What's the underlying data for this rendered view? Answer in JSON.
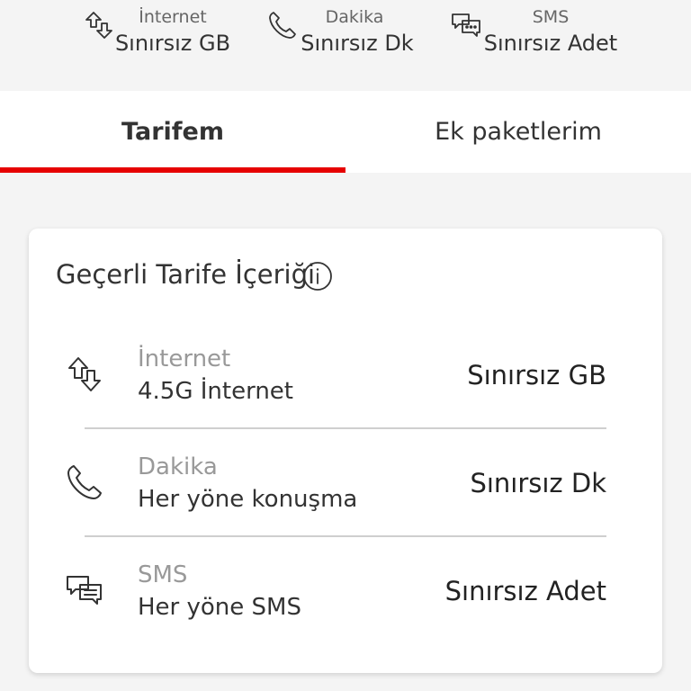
{
  "summary": {
    "items": [
      {
        "label": "İnternet",
        "value": "Sınırsız GB",
        "icon": "data-transfer-icon"
      },
      {
        "label": "Dakika",
        "value": "Sınırsız Dk",
        "icon": "phone-icon"
      },
      {
        "label": "SMS",
        "value": "Sınırsız Adet",
        "icon": "message-icon"
      }
    ]
  },
  "tabs": [
    {
      "label": "Tarifem",
      "active": true
    },
    {
      "label": "Ek paketlerim",
      "active": false
    }
  ],
  "card": {
    "title": "Geçerli Tarife İçeriği",
    "rows": [
      {
        "label": "İnternet",
        "sub": "4.5G İnternet",
        "value": "Sınırsız GB",
        "icon": "data-transfer-icon"
      },
      {
        "label": "Dakika",
        "sub": "Her yöne konuşma",
        "value": "Sınırsız Dk",
        "icon": "phone-icon"
      },
      {
        "label": "SMS",
        "sub": "Her yöne SMS",
        "value": "Sınırsız Adet",
        "icon": "message-icon"
      }
    ]
  },
  "colors": {
    "accent": "#e60000",
    "background": "#f4f4f4",
    "card": "#ffffff"
  }
}
